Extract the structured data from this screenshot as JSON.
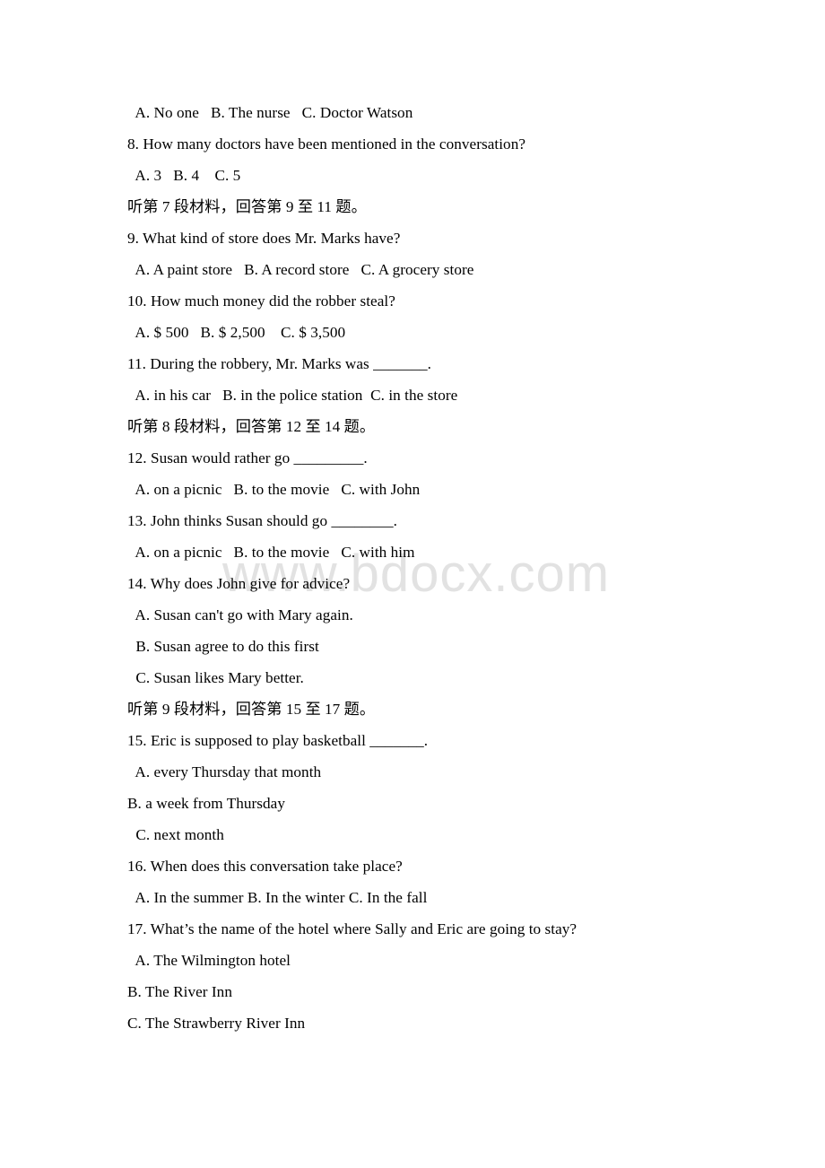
{
  "document": {
    "type": "exam-paper",
    "language": "mixed-english-chinese",
    "page_background": "#ffffff",
    "text_color": "#000000"
  },
  "watermark": {
    "text": "www.bdocx.com",
    "color": "#e2e2e2"
  },
  "lines": [
    {
      "id": "q7-options",
      "kind": "option",
      "indent": "opt",
      "text": " A. No one   B. The nurse   C. Doctor Watson"
    },
    {
      "id": "q8-stem",
      "kind": "question",
      "indent": "q",
      "text": "8. How many doctors have been mentioned in the conversation?"
    },
    {
      "id": "q8-options",
      "kind": "option",
      "indent": "opt",
      "text": " A. 3   B. 4    C. 5"
    },
    {
      "id": "dir-7",
      "kind": "direction",
      "indent": "q",
      "text": "听第 7 段材料，回答第 9 至 11 题。"
    },
    {
      "id": "q9-stem",
      "kind": "question",
      "indent": "q",
      "text": "9. What kind of store does Mr. Marks have?"
    },
    {
      "id": "q9-options",
      "kind": "option",
      "indent": "opt",
      "text": " A. A paint store   B. A record store   C. A grocery store"
    },
    {
      "id": "q10-stem",
      "kind": "question",
      "indent": "q",
      "text": "10. How much money did the robber steal?"
    },
    {
      "id": "q10-options",
      "kind": "option",
      "indent": "opt",
      "text": " A. $ 500   B. $ 2,500    C. $ 3,500"
    },
    {
      "id": "q11-stem",
      "kind": "question",
      "indent": "q",
      "text": "11. During the robbery, Mr. Marks was _______."
    },
    {
      "id": "q11-options",
      "kind": "option",
      "indent": "opt",
      "text": " A. in his car   B. in the police station  C. in the store"
    },
    {
      "id": "dir-8",
      "kind": "direction",
      "indent": "q",
      "text": "听第 8 段材料，回答第 12 至 14 题。"
    },
    {
      "id": "q12-stem",
      "kind": "question",
      "indent": "q",
      "text": "12. Susan would rather go _________."
    },
    {
      "id": "q12-options",
      "kind": "option",
      "indent": "opt",
      "text": " A. on a picnic   B. to the movie   C. with John"
    },
    {
      "id": "q13-stem",
      "kind": "question",
      "indent": "q",
      "text": "13. John thinks Susan should go ________."
    },
    {
      "id": "q13-options",
      "kind": "option",
      "indent": "opt",
      "text": " A. on a picnic   B. to the movie   C. with him"
    },
    {
      "id": "q14-stem",
      "kind": "question",
      "indent": "q",
      "text": "14. Why does John give for advice?"
    },
    {
      "id": "q14-option-a",
      "kind": "option",
      "indent": "opt",
      "text": " A. Susan can't go with Mary again."
    },
    {
      "id": "q14-option-b",
      "kind": "option",
      "indent": "opt",
      "text": " B. Susan agree to do this first"
    },
    {
      "id": "q14-option-c",
      "kind": "option",
      "indent": "opt",
      "text": " C. Susan likes Mary better."
    },
    {
      "id": "dir-9",
      "kind": "direction",
      "indent": "q",
      "text": "听第 9 段材料，回答第 15 至 17 题。"
    },
    {
      "id": "q15-stem",
      "kind": "question",
      "indent": "q",
      "text": "15. Eric is supposed to play basketball _______."
    },
    {
      "id": "q15-option-a",
      "kind": "option",
      "indent": "opt",
      "text": " A. every Thursday that month"
    },
    {
      "id": "q15-option-b",
      "kind": "option",
      "indent": "opt-flush",
      "text": "B. a week from Thursday"
    },
    {
      "id": "q15-option-c",
      "kind": "option",
      "indent": "opt",
      "text": " C. next month"
    },
    {
      "id": "q16-stem",
      "kind": "question",
      "indent": "q",
      "text": "16. When does this conversation take place?"
    },
    {
      "id": "q16-options",
      "kind": "option",
      "indent": "opt",
      "text": " A. In the summer B. In the winter C. In the fall"
    },
    {
      "id": "q17-stem",
      "kind": "question",
      "indent": "q",
      "text": "17. What’s the name of the hotel where Sally and Eric are going to stay?"
    },
    {
      "id": "q17-option-a",
      "kind": "option",
      "indent": "opt",
      "text": " A. The Wilmington hotel"
    },
    {
      "id": "q17-option-b",
      "kind": "option",
      "indent": "opt-flush",
      "text": "B. The River Inn"
    },
    {
      "id": "q17-option-c",
      "kind": "option",
      "indent": "opt-flush",
      "text": "C. The Strawberry River Inn"
    }
  ]
}
